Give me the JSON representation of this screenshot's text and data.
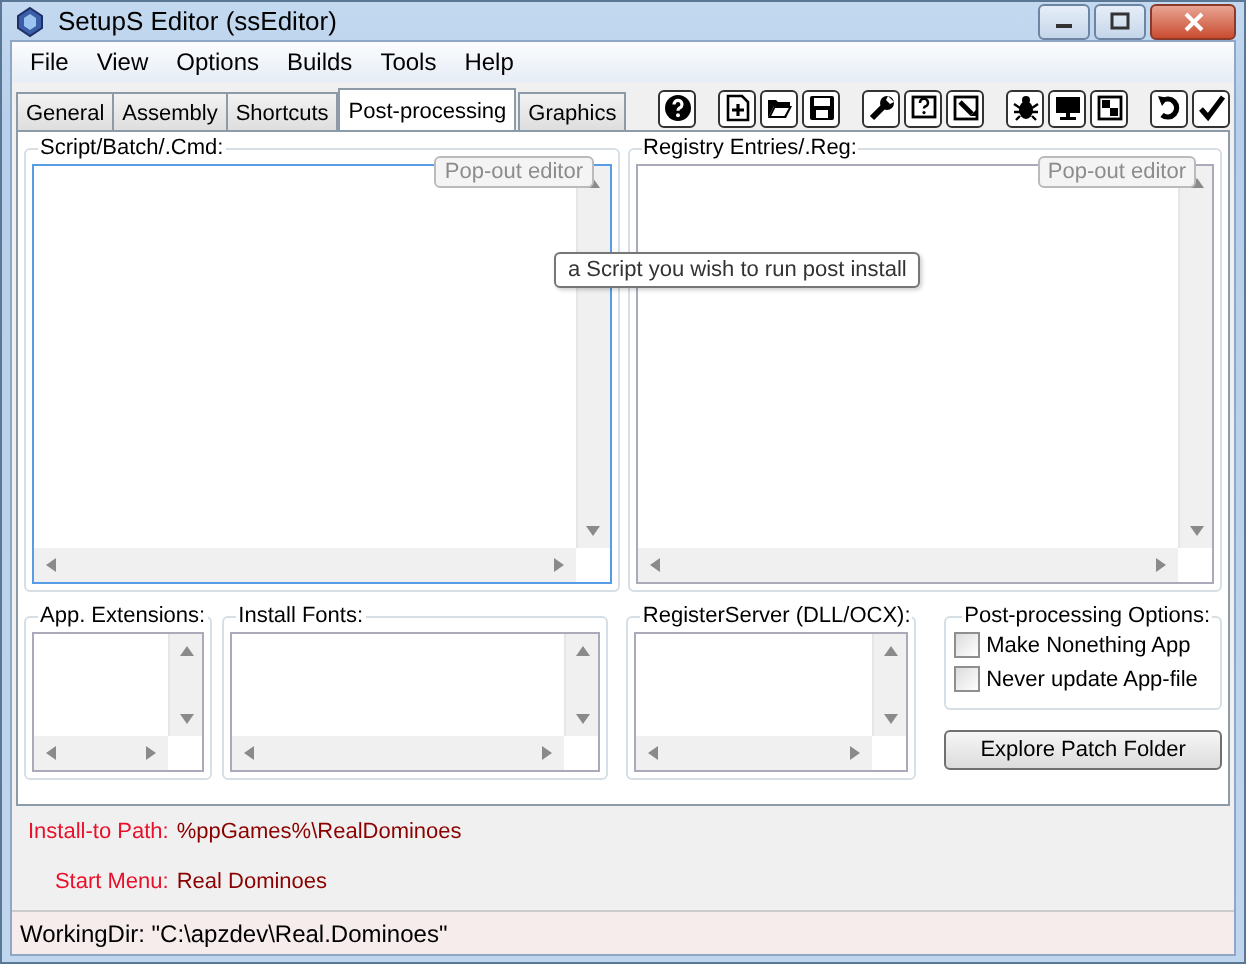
{
  "window": {
    "title": "SetupS Editor (ssEditor)"
  },
  "menu": [
    "File",
    "View",
    "Options",
    "Builds",
    "Tools",
    "Help"
  ],
  "tabs": [
    {
      "label": "General",
      "selected": false
    },
    {
      "label": "Assembly",
      "selected": false
    },
    {
      "label": "Shortcuts",
      "selected": false
    },
    {
      "label": "Post-processing",
      "selected": true
    },
    {
      "label": "Graphics",
      "selected": false
    }
  ],
  "toolbar": [
    {
      "kind": "help"
    },
    {
      "kind": "sep"
    },
    {
      "kind": "new"
    },
    {
      "kind": "open"
    },
    {
      "kind": "save"
    },
    {
      "kind": "sep"
    },
    {
      "kind": "wrench"
    },
    {
      "kind": "helpwin"
    },
    {
      "kind": "edit"
    },
    {
      "kind": "sep"
    },
    {
      "kind": "bug"
    },
    {
      "kind": "monitor"
    },
    {
      "kind": "window"
    },
    {
      "kind": "sep"
    },
    {
      "kind": "undo"
    },
    {
      "kind": "check"
    }
  ],
  "editors": [
    {
      "label": "Script/Batch/.Cmd:",
      "button": {
        "label": "Pop-out editor",
        "disabled": true
      },
      "focused": true
    },
    {
      "label": "Registry Entries/.Reg:",
      "button": {
        "label": "Pop-out editor",
        "disabled": true
      },
      "focused": false
    }
  ],
  "tooltip": "a Script you wish to run post install",
  "lists": [
    {
      "label": "App. Extensions:"
    },
    {
      "label": "Install Fonts:"
    },
    {
      "label": "RegisterServer (DLL/OCX):"
    }
  ],
  "options": {
    "title": "Post-processing Options:",
    "items": [
      {
        "label": "Make Nonething App",
        "checked": false
      },
      {
        "label": "Never update App-file",
        "checked": false
      }
    ]
  },
  "explore_button": "Explore Patch Folder",
  "info": [
    {
      "label": "Install-to Path:",
      "value": "%ppGames%\\RealDominoes"
    },
    {
      "label": "Start Menu:",
      "value": "Real Dominoes"
    }
  ],
  "status_bar": "WorkingDir: \"C:\\apzdev\\Real.Dominoes\""
}
